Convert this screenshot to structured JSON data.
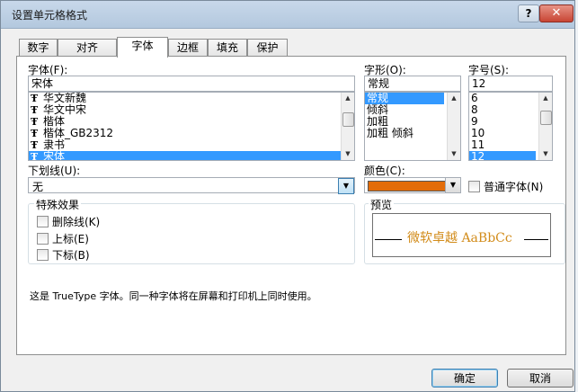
{
  "dialog": {
    "title": "设置单元格格式",
    "help_label": "?",
    "close_label": "✕"
  },
  "tabs": [
    {
      "label": "数字",
      "active": false
    },
    {
      "label": "对齐",
      "active": false
    },
    {
      "label": "字体",
      "active": true
    },
    {
      "label": "边框",
      "active": false
    },
    {
      "label": "填充",
      "active": false
    },
    {
      "label": "保护",
      "active": false
    }
  ],
  "font": {
    "label": "字体(F):",
    "value": "宋体",
    "items": [
      "华文新魏",
      "华文中宋",
      "楷体",
      "楷体_GB2312",
      "隶书",
      "宋体"
    ],
    "selected": "宋体"
  },
  "style": {
    "label": "字形(O):",
    "value": "常规",
    "items": [
      "常规",
      "倾斜",
      "加粗",
      "加粗 倾斜"
    ],
    "selected": "常规"
  },
  "size": {
    "label": "字号(S):",
    "value": "12",
    "items": [
      "6",
      "8",
      "9",
      "10",
      "11",
      "12"
    ],
    "selected": "12"
  },
  "underline": {
    "label": "下划线(U):",
    "value": "无"
  },
  "color": {
    "label": "颜色(C):",
    "value_hex": "#e36c09",
    "normal_font_label": "普通字体(N)"
  },
  "effects": {
    "title": "特殊效果",
    "strikethrough": "删除线(K)",
    "superscript": "上标(E)",
    "subscript": "下标(B)"
  },
  "preview": {
    "title": "预览",
    "sample": "微软卓越  AaBbCc",
    "sample_color": "#d28c1b"
  },
  "note": "这是 TrueType 字体。同一种字体将在屏幕和打印机上同时使用。",
  "buttons": {
    "ok": "确定",
    "cancel": "取消"
  }
}
